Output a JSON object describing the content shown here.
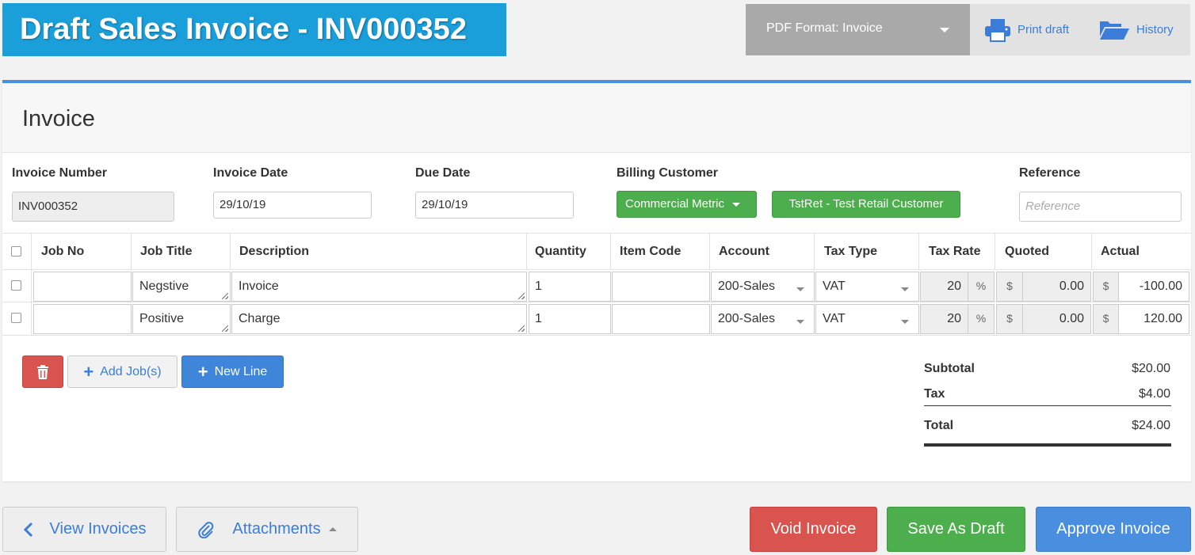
{
  "header": {
    "title": "Draft Sales Invoice - INV000352",
    "pdf_format_label": "PDF Format: Invoice",
    "print_label": "Print draft",
    "history_label": "History"
  },
  "panel": {
    "title": "Invoice",
    "invoice_number_label": "Invoice Number",
    "invoice_number_value": "INV000352",
    "invoice_date_label": "Invoice Date",
    "invoice_date_value": "29/10/19",
    "due_date_label": "Due Date",
    "due_date_value": "29/10/19",
    "billing_customer_label": "Billing Customer",
    "billing_customer_type": "Commercial Metric",
    "billing_customer_name": "TstRet - Test Retail Customer",
    "reference_label": "Reference",
    "reference_placeholder": "Reference"
  },
  "table": {
    "headers": {
      "job_no": "Job No",
      "job_title": "Job Title",
      "description": "Description",
      "quantity": "Quantity",
      "item_code": "Item Code",
      "account": "Account",
      "tax_type": "Tax Type",
      "tax_rate": "Tax Rate",
      "quoted": "Quoted",
      "actual": "Actual"
    },
    "rows": [
      {
        "job_no": "",
        "job_title": "Negstive",
        "description": "Invoice",
        "quantity": "1",
        "item_code": "",
        "account": "200-Sales",
        "tax_type": "VAT",
        "tax_rate": "20",
        "quoted": "0.00",
        "actual": "-100.00"
      },
      {
        "job_no": "",
        "job_title": "Positive",
        "description": "Charge",
        "quantity": "1",
        "item_code": "",
        "account": "200-Sales",
        "tax_type": "VAT",
        "tax_rate": "20",
        "quoted": "0.00",
        "actual": "120.00"
      }
    ],
    "percent_symbol": "%",
    "currency_symbol": "$"
  },
  "actions": {
    "add_jobs_label": "Add Job(s)",
    "new_line_label": "New Line"
  },
  "totals": {
    "subtotal_label": "Subtotal",
    "subtotal_value": "$20.00",
    "tax_label": "Tax",
    "tax_value": "$4.00",
    "total_label": "Total",
    "total_value": "$24.00"
  },
  "footer": {
    "view_invoices_label": "View Invoices",
    "attachments_label": "Attachments",
    "void_label": "Void Invoice",
    "save_draft_label": "Save As Draft",
    "approve_label": "Approve Invoice"
  },
  "colors": {
    "banner": "#1a9fdb",
    "accent_blue": "#3b7dd8",
    "success": "#4cae4c",
    "danger": "#d9534f",
    "primary": "#4a8ee0"
  }
}
